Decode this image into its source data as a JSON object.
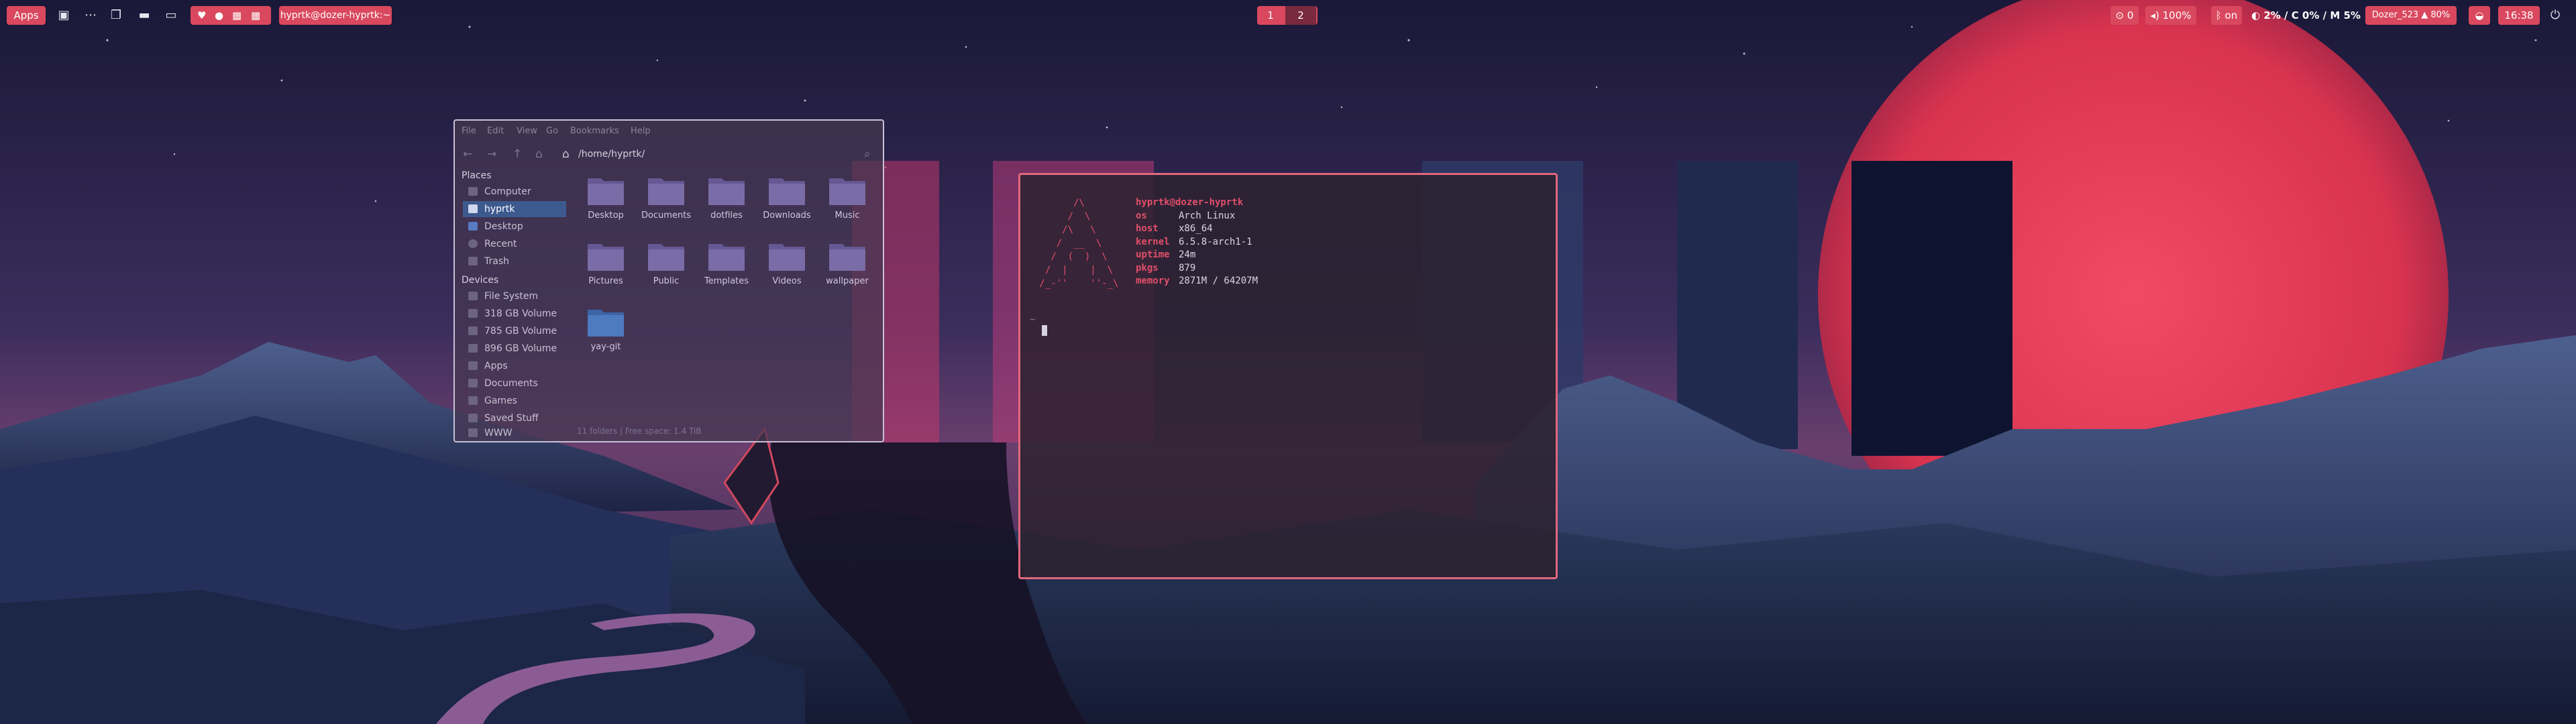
{
  "topbar": {
    "apps_label": "Apps",
    "window_title": "hyprtk@dozer-hyprtk:~",
    "workspaces": [
      "1",
      "2"
    ],
    "notifications": "0",
    "volume": "100%",
    "bluetooth": "on",
    "cpu_mem": "2% / C 0% / M 5%",
    "wifi": "Dozer_523 ▲ 80%",
    "clock": "16:38"
  },
  "file_manager": {
    "menu": [
      "File",
      "Edit",
      "View",
      "Go",
      "Bookmarks",
      "Help"
    ],
    "path": "/home/hyprtk/",
    "places_header": "Places",
    "places": [
      "Computer",
      "hyprtk",
      "Desktop",
      "Recent",
      "Trash"
    ],
    "devices_header": "Devices",
    "devices": [
      "File System",
      "318 GB Volume",
      "785 GB Volume",
      "896 GB Volume",
      "Apps",
      "Documents",
      "Games",
      "Saved Stuff",
      "WWW"
    ],
    "folders": [
      "Desktop",
      "Documents",
      "dotfiles",
      "Downloads",
      "Music",
      "Pictures",
      "Public",
      "Templates",
      "Videos",
      "wallpaper",
      "yay-git"
    ],
    "status": "11 folders  |  Free space: 1.4 TiB"
  },
  "terminal": {
    "user_host": "hyprtk@dozer-hyprtk",
    "rows": [
      {
        "key": "os",
        "value": "Arch Linux"
      },
      {
        "key": "host",
        "value": "x86_64"
      },
      {
        "key": "kernel",
        "value": "6.5.8-arch1-1"
      },
      {
        "key": "uptime",
        "value": "24m"
      },
      {
        "key": "pkgs",
        "value": "879"
      },
      {
        "key": "memory",
        "value": "2871M / 64207M"
      }
    ],
    "prompt": "~"
  },
  "colors": {
    "accent": "#d9485e",
    "terminal_border": "#e0687d",
    "selection": "#3d5a8f"
  }
}
